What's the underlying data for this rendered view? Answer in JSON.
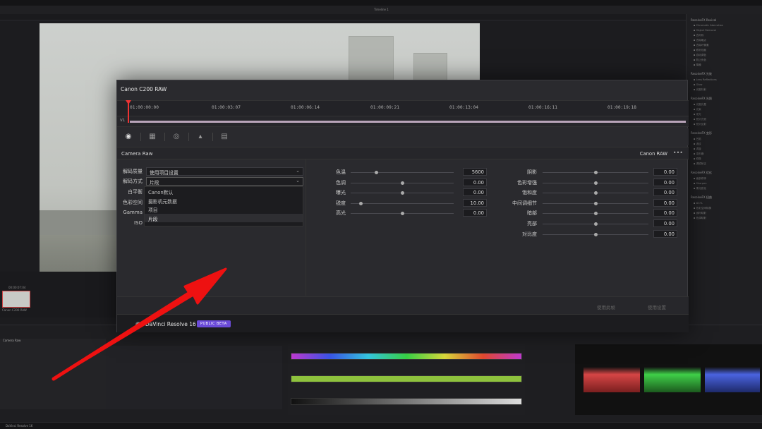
{
  "dialog": {
    "title": "Canon C200 RAW",
    "timecodes": [
      "01:00:00:00",
      "01:00:03:07",
      "01:00:06:14",
      "01:00:09:21",
      "01:00:13:04",
      "01:00:16:11",
      "01:00:19:18"
    ],
    "track_label": "V1",
    "section_left": "Camera Raw",
    "section_right": "Canon RAW",
    "fields": [
      {
        "label": "解码质量",
        "value": "使用项目设置",
        "dropdown": true
      },
      {
        "label": "解码方式",
        "value": "片段",
        "dropdown": true
      },
      {
        "label": "白平衡",
        "value": ""
      },
      {
        "label": "色彩空间",
        "value": ""
      },
      {
        "label": "Gamma",
        "value": ""
      },
      {
        "label": "ISO",
        "value": ""
      }
    ],
    "dropdown_options": [
      "Canon默认",
      "摄影机元数据",
      "项目",
      "片段"
    ],
    "dropdown_selected": "片段",
    "sliders_mid": [
      {
        "label": "色温",
        "value": "5600",
        "pos": 0.25
      },
      {
        "label": "色调",
        "value": "0.00",
        "pos": 0.5
      },
      {
        "label": "曝光",
        "value": "0.00",
        "pos": 0.5
      },
      {
        "label": "锐度",
        "value": "10.00",
        "pos": 0.1
      },
      {
        "label": "高光",
        "value": "0.00",
        "pos": 0.5
      }
    ],
    "sliders_right": [
      {
        "label": "阴影",
        "value": "0.00",
        "pos": 0.5
      },
      {
        "label": "色彩增强",
        "value": "0.00",
        "pos": 0.5
      },
      {
        "label": "饱和度",
        "value": "0.00",
        "pos": 0.5
      },
      {
        "label": "中间调细节",
        "value": "0.00",
        "pos": 0.5
      },
      {
        "label": "暗部",
        "value": "0.00",
        "pos": 0.5
      },
      {
        "label": "亮部",
        "value": "0.00",
        "pos": 0.5
      },
      {
        "label": "对比度",
        "value": "0.00",
        "pos": 0.5
      }
    ],
    "button_left": "使用此帧",
    "button_right": "使用设置",
    "app_name": "DaVinci Resolve 16",
    "beta_badge": "PUBLIC BETA"
  },
  "background": {
    "timeline_name": "Timeline 1",
    "clip_timecode": "00:00:07:04",
    "clip_name": "Canon C200 RAW",
    "mini_title": "Camera Raw",
    "statusbar_app": "DaVinci Resolve 16",
    "right_panel_groups": [
      {
        "head": "ResolveFX Revival",
        "items": [
          "Chromatic Aberration",
          "Object Removal",
          "去闪烁",
          "去除噪点",
          "去除坏像素",
          "修补划痕",
          "自动调色",
          "防止伪色",
          "降噪"
        ]
      },
      {
        "head": "ResolveFX 光效",
        "items": [
          "Lens Reflections",
          "Glow",
          "光圈衍射"
        ]
      },
      {
        "head": "ResolveFX 光照",
        "items": [
          "光圈光晕",
          "光束",
          "发光",
          "镜头光斑",
          "镜头反射"
        ]
      },
      {
        "head": "ResolveFX 变形",
        "items": [
          "凹陷",
          "波纹",
          "涡旋",
          "变形器",
          "镜像",
          "透镜矫正"
        ]
      },
      {
        "head": "ResolveFX 优化",
        "items": [
          "面部修饰",
          "Sharpen",
          "柔化锐化"
        ]
      },
      {
        "head": "ResolveFX 扭曲",
        "items": [
          "DCTL",
          "色彩空间转换",
          "伽玛映射",
          "色调映射"
        ]
      }
    ]
  }
}
